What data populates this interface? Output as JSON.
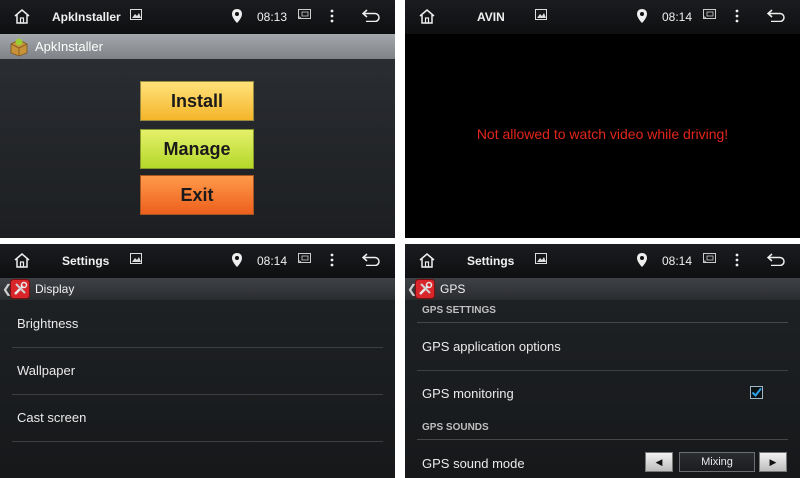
{
  "panels": {
    "apk": {
      "status": {
        "title": "ApkInstaller",
        "time": "08:13"
      },
      "app_title": "ApkInstaller",
      "buttons": {
        "install": "Install",
        "manage": "Manage",
        "exit": "Exit"
      }
    },
    "avin": {
      "status": {
        "title": "AVIN",
        "time": "08:14"
      },
      "warning": "Not allowed to watch video while driving!"
    },
    "display": {
      "status": {
        "title": "Settings",
        "time": "08:14"
      },
      "header_title": "Display",
      "items": [
        "Brightness",
        "Wallpaper",
        "Cast screen"
      ]
    },
    "gps": {
      "status": {
        "title": "Settings",
        "time": "08:14"
      },
      "header_title": "GPS",
      "section_settings": "GPS SETTINGS",
      "app_options": "GPS application options",
      "monitoring": "GPS monitoring",
      "monitoring_checked": true,
      "section_sounds": "GPS SOUNDS",
      "sound_mode": "GPS sound mode",
      "sound_mode_value": "Mixing"
    }
  },
  "colors": {
    "warning": "#e2261c",
    "install": "#f4b52a",
    "manage": "#b4d82a",
    "exit": "#ed5f1d",
    "checkmark": "#2aa3e6"
  },
  "icons": [
    "home-icon",
    "gallery-icon",
    "location-pin-icon",
    "cast-icon",
    "overflow-menu-icon",
    "back-icon",
    "android-box-icon",
    "settings-tools-icon",
    "checkmark-icon",
    "arrow-left-icon",
    "arrow-right-icon"
  ]
}
